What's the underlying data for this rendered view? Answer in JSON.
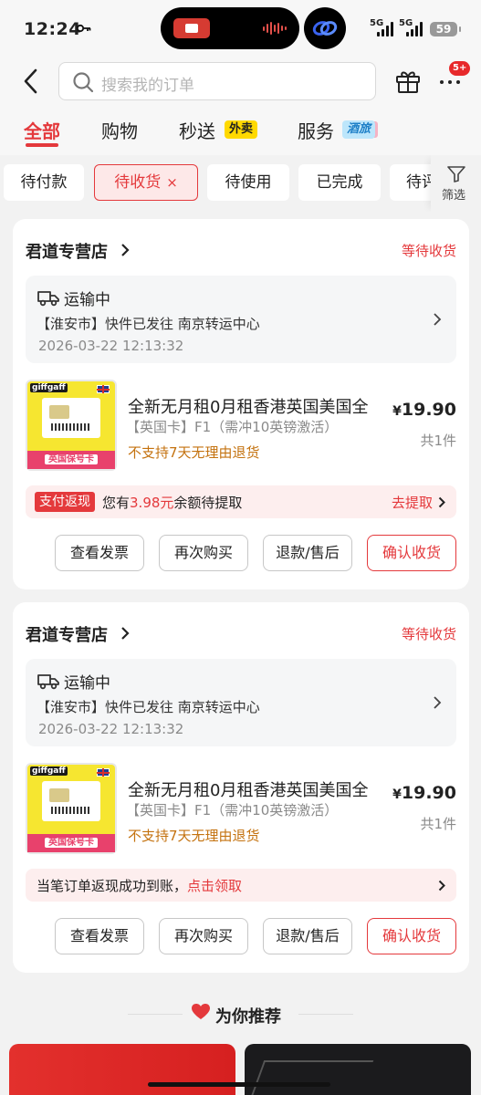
{
  "status_bar": {
    "time": "12:24",
    "network1": "5G",
    "network2": "5G",
    "battery": "59"
  },
  "header": {
    "search_placeholder": "搜索我的订单",
    "more_badge": "5+"
  },
  "tabs": [
    {
      "label": "全部",
      "active": true
    },
    {
      "label": "购物",
      "active": false
    },
    {
      "label": "秒送",
      "tag": "外卖",
      "active": false
    },
    {
      "label": "服务",
      "tag": "酒旅",
      "active": false
    }
  ],
  "filters": {
    "chips": [
      "待付款",
      "待收货",
      "待使用",
      "已完成",
      "待评价"
    ],
    "active_close": "×",
    "filter_label": "筛选"
  },
  "orders": [
    {
      "store": "君道专营店",
      "status": "等待收货",
      "shipping": {
        "title": "运输中",
        "detail": "【淮安市】快件已发往 南京转运中心",
        "time": "2026-03-22 12:13:32"
      },
      "product": {
        "title": "全新无月租0月租香港英国美国全",
        "spec": "【英国卡】F1（需冲10英镑激活）",
        "note": "不支持7天无理由退货",
        "currency": "¥",
        "price": "19.90",
        "qty": "共1件",
        "thumb_brand": "giffgaff",
        "thumb_label": "英国保号卡"
      },
      "promo": {
        "tag": "支付返现",
        "text_prefix": "您有",
        "amount": "3.98元",
        "text_suffix": "余额待提取",
        "link": "去提取"
      },
      "buttons": [
        "查看发票",
        "再次购买",
        "退款/售后",
        "确认收货"
      ]
    },
    {
      "store": "君道专营店",
      "status": "等待收货",
      "shipping": {
        "title": "运输中",
        "detail": "【淮安市】快件已发往 南京转运中心",
        "time": "2026-03-22 12:13:32"
      },
      "product": {
        "title": "全新无月租0月租香港英国美国全",
        "spec": "【英国卡】F1（需冲10英镑激活）",
        "note": "不支持7天无理由退货",
        "currency": "¥",
        "price": "19.90",
        "qty": "共1件",
        "thumb_brand": "giffgaff",
        "thumb_label": "英国保号卡"
      },
      "promo": {
        "text_prefix": "当笔订单返现成功到账，",
        "link_inline": "点击领取"
      },
      "buttons": [
        "查看发票",
        "再次购买",
        "退款/售后",
        "确认收货"
      ]
    }
  ],
  "recommend": {
    "title": "为你推荐"
  },
  "colors": {
    "accent": "#e4393c",
    "warning_text": "#c4720f",
    "page_bg": "#f2f2f2"
  },
  "icons": [
    "key-icon",
    "back-icon",
    "search-icon",
    "gift-icon",
    "more-icon",
    "filter-icon",
    "truck-icon",
    "chevron-right-icon",
    "heart-icon"
  ]
}
